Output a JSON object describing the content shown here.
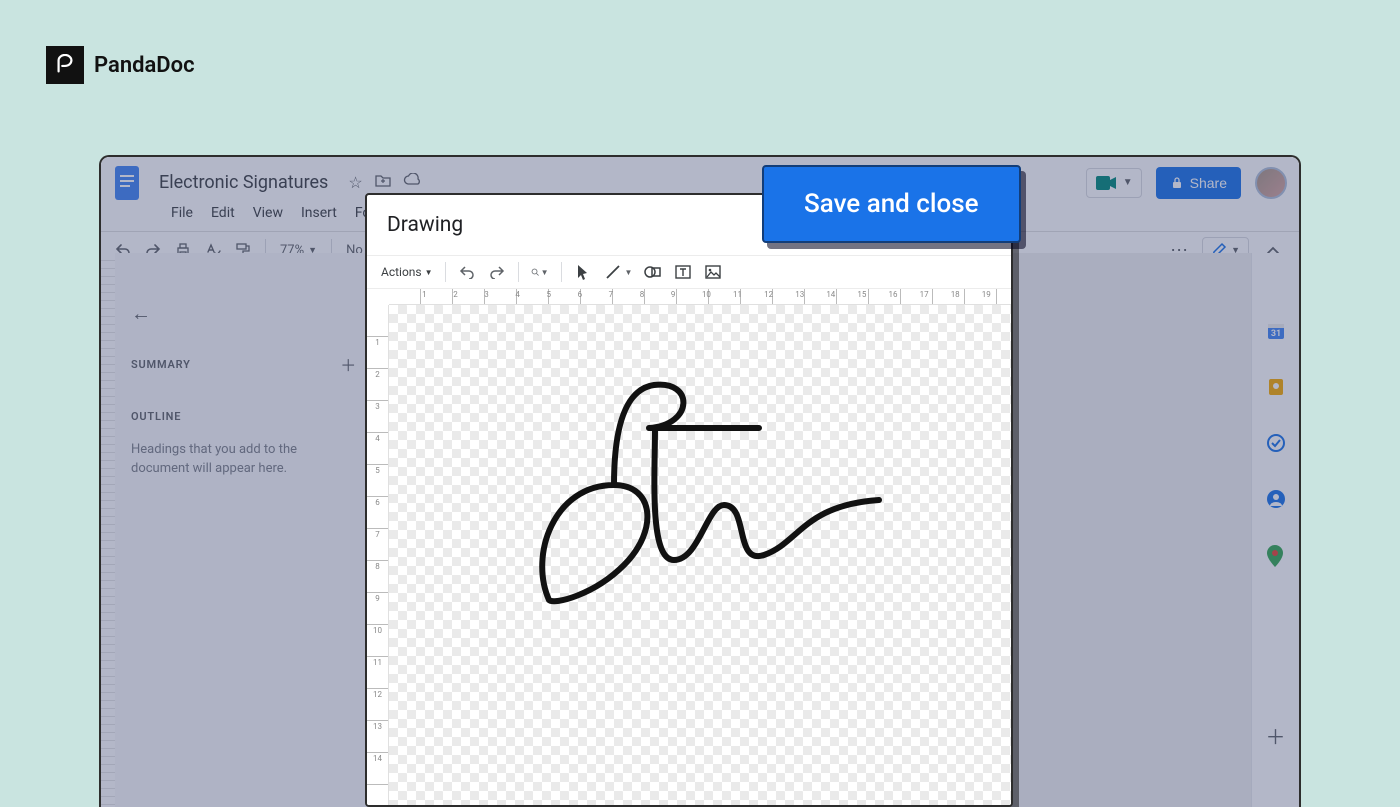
{
  "brand": {
    "name": "PandaDoc"
  },
  "doc": {
    "title": "Electronic Signatures",
    "menus": {
      "file": "File",
      "edit": "Edit",
      "view": "View",
      "insert": "Insert",
      "format": "Form"
    },
    "zoom": "77%",
    "style_label": "No",
    "share_label": "Share",
    "ellipsis": "⋯"
  },
  "sidebar": {
    "summary_label": "SUMMARY",
    "outline_label": "OUTLINE",
    "outline_placeholder": "Headings that you add to the document will appear here."
  },
  "modal": {
    "title": "Drawing",
    "actions_label": "Actions",
    "hruler": [
      "",
      "1",
      "2",
      "3",
      "4",
      "5",
      "6",
      "7",
      "8",
      "9",
      "10",
      "11",
      "12",
      "13",
      "14",
      "15",
      "16",
      "17",
      "18",
      "19"
    ],
    "vruler": [
      "",
      "1",
      "2",
      "3",
      "4",
      "5",
      "6",
      "7",
      "8",
      "9",
      "10",
      "11",
      "12",
      "13",
      "14"
    ]
  },
  "callout": {
    "text": "Save and close"
  },
  "siderail_colors": {
    "calendar": "#e67c29",
    "keep": "#f9ab00",
    "tasks": "#1a73e8",
    "contacts": "#1a73e8",
    "maps": "#d93025"
  }
}
